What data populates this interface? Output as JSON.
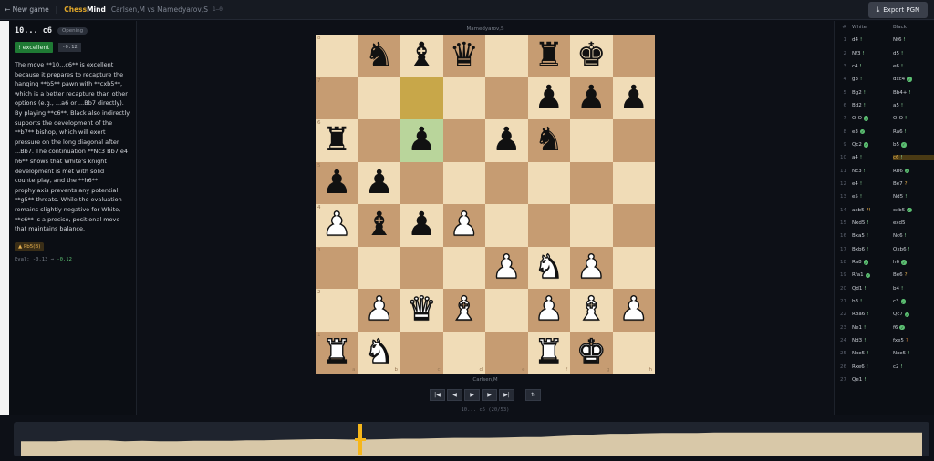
{
  "header": {
    "new_game": "← New game",
    "brand_a": "Chess",
    "brand_b": "Mind",
    "matchup": "Carlsen,M vs Mamedyarov,S",
    "score": "1–0",
    "export_label": "Export PGN",
    "export_icon": "download-icon"
  },
  "analysis": {
    "move": "10... c6",
    "phase": "Opening",
    "classification": "! excellent",
    "eval_chip": "-0.12",
    "explanation": "The move **10...c6** is excellent because it prepares to recapture the hanging **b5** pawn with **cxb5**, which is a better recapture than other options (e.g., ...a6 or ...Bb7 directly). By playing **c6**, Black also indirectly supports the development of the **b7** bishop, which will exert pressure on the long diagonal after ...Bb7. The continuation **Nc3 Bb7 e4 h6** shows that White's knight development is met with solid counterplay, and the **h6** prophylaxis prevents any potential **g5** threats. While the evaluation remains slightly negative for White, **c6** is a precise, positional move that maintains balance.",
    "tag": "▲ Pb5(B)",
    "eval_from": "Eval: -0.13 →",
    "eval_to": "-0.12"
  },
  "board": {
    "top_player": "Mamedyarov,S",
    "bottom_player": "Carlsen,M",
    "ranks": [
      "8",
      "7",
      "6",
      "5",
      "4",
      "3",
      "2",
      "1"
    ],
    "files": [
      "a",
      "b",
      "c",
      "d",
      "e",
      "f",
      "g",
      "h"
    ],
    "position": [
      [
        "",
        "n",
        "b",
        "q",
        "",
        "r",
        "k",
        ""
      ],
      [
        "",
        "",
        "",
        "",
        "",
        "p",
        "p",
        "p"
      ],
      [
        "r",
        "",
        "p",
        "",
        "p",
        "n",
        "",
        ""
      ],
      [
        "p",
        "p",
        "",
        "",
        "",
        "",
        "",
        ""
      ],
      [
        "P",
        "b",
        "p",
        "P",
        "",
        "",
        "",
        ""
      ],
      [
        "",
        "",
        "",
        "",
        "P",
        "N",
        "P",
        ""
      ],
      [
        "",
        "P",
        "Q",
        "B",
        "",
        "P",
        "B",
        "P"
      ],
      [
        "R",
        "N",
        "",
        "",
        "",
        "R",
        "K",
        ""
      ]
    ],
    "highlight_from": "c7",
    "highlight_to": "c6",
    "caption": "10... c6 (20/53)"
  },
  "controls": {
    "first": "|◀",
    "prev": "◀",
    "play": "▶",
    "next": "▶",
    "last": "▶|",
    "flip": "⇅"
  },
  "moves_header": {
    "num": "#",
    "white": "White",
    "black": "Black"
  },
  "moves": [
    {
      "n": "1",
      "w": "d4",
      "wm": "!",
      "b": "Nf6",
      "bm": "!"
    },
    {
      "n": "2",
      "w": "Nf3",
      "wm": "!",
      "b": "d5",
      "bm": "!"
    },
    {
      "n": "3",
      "w": "c4",
      "wm": "!",
      "b": "e6",
      "bm": "!"
    },
    {
      "n": "4",
      "w": "g3",
      "wm": "!",
      "b": "dxc4",
      "bm": "●"
    },
    {
      "n": "5",
      "w": "Bg2",
      "wm": "!",
      "b": "Bb4+",
      "bm": "!"
    },
    {
      "n": "6",
      "w": "Bd2",
      "wm": "!",
      "b": "a5",
      "bm": "!"
    },
    {
      "n": "7",
      "w": "O-O",
      "wm": "●",
      "b": "O-O",
      "bm": "!"
    },
    {
      "n": "8",
      "w": "e3",
      "wm": "●",
      "b": "Ra6",
      "bm": "!"
    },
    {
      "n": "9",
      "w": "Qc2",
      "wm": "●",
      "b": "b5",
      "bm": "●"
    },
    {
      "n": "10",
      "w": "a4",
      "wm": "!",
      "b": "c6",
      "bm": "!"
    },
    {
      "n": "11",
      "w": "Nc3",
      "wm": "!",
      "b": "Rb6",
      "bm": "●"
    },
    {
      "n": "12",
      "w": "e4",
      "wm": "!",
      "b": "Be7",
      "bm": "?!"
    },
    {
      "n": "13",
      "w": "e5",
      "wm": "!",
      "b": "Nd5",
      "bm": "!"
    },
    {
      "n": "14",
      "w": "axb5",
      "wm": "?!",
      "b": "cxb5",
      "bm": "●"
    },
    {
      "n": "15",
      "w": "Nxd5",
      "wm": "!",
      "b": "exd5",
      "bm": "!"
    },
    {
      "n": "16",
      "w": "Bxa5",
      "wm": "!",
      "b": "Nc6",
      "bm": "!"
    },
    {
      "n": "17",
      "w": "Bxb6",
      "wm": "!",
      "b": "Qxb6",
      "bm": "!"
    },
    {
      "n": "18",
      "w": "Ra8",
      "wm": "●",
      "b": "h6",
      "bm": "●"
    },
    {
      "n": "19",
      "w": "Rfa1",
      "wm": "●",
      "b": "Be6",
      "bm": "?!"
    },
    {
      "n": "20",
      "w": "Qd1",
      "wm": "!",
      "b": "b4",
      "bm": "!"
    },
    {
      "n": "21",
      "w": "b3",
      "wm": "!",
      "b": "c3",
      "bm": "●"
    },
    {
      "n": "22",
      "w": "R8a6",
      "wm": "!",
      "b": "Qc7",
      "bm": "●"
    },
    {
      "n": "23",
      "w": "Ne1",
      "wm": "!",
      "b": "f6",
      "bm": "●"
    },
    {
      "n": "24",
      "w": "Nd3",
      "wm": "!",
      "b": "fxe5",
      "bm": "?"
    },
    {
      "n": "25",
      "w": "Nxe5",
      "wm": "!",
      "b": "Nxe5",
      "bm": "!"
    },
    {
      "n": "26",
      "w": "Rxe6",
      "wm": "!",
      "b": "c2",
      "bm": "!"
    },
    {
      "n": "27",
      "w": "Qe1",
      "wm": "!",
      "b": "",
      "bm": ""
    }
  ],
  "current_move_index": 9,
  "eval_graph": {
    "values": [
      0.1,
      0.1,
      0.1,
      0.15,
      0.15,
      0.15,
      0.1,
      0.12,
      0.1,
      0.1,
      0.12,
      0.12,
      0.12,
      0.15,
      0.15,
      0.18,
      0.2,
      0.22,
      0.22,
      0.2,
      0.2,
      0.22,
      0.25,
      0.25,
      0.28,
      0.3,
      0.3,
      0.3,
      0.32,
      0.35,
      0.35,
      0.4,
      0.45,
      0.5,
      0.55,
      0.55,
      0.58,
      0.6,
      0.6,
      0.6,
      0.62,
      0.62,
      0.62,
      0.62,
      0.62,
      0.62,
      0.62,
      0.62,
      0.62,
      0.62,
      0.62,
      0.62,
      0.62
    ],
    "current": 20,
    "accent": "#f5b61b",
    "fill": "#d8c8a8"
  }
}
